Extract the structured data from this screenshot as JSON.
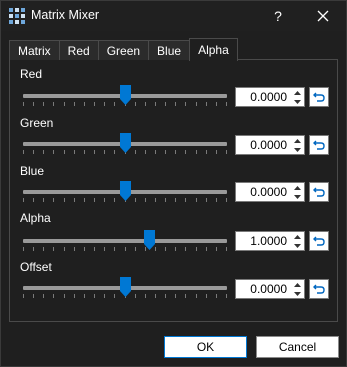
{
  "window": {
    "title": "Matrix Mixer",
    "help_label": "?"
  },
  "tabs": [
    {
      "label": "Matrix",
      "active": false
    },
    {
      "label": "Red",
      "active": false
    },
    {
      "label": "Green",
      "active": false
    },
    {
      "label": "Blue",
      "active": false
    },
    {
      "label": "Alpha",
      "active": true
    }
  ],
  "rows": [
    {
      "label": "Red",
      "value": "0.0000",
      "slider_fraction": 0.5
    },
    {
      "label": "Green",
      "value": "0.0000",
      "slider_fraction": 0.5
    },
    {
      "label": "Blue",
      "value": "0.0000",
      "slider_fraction": 0.5
    },
    {
      "label": "Alpha",
      "value": "1.0000",
      "slider_fraction": 0.62
    },
    {
      "label": "Offset",
      "value": "0.0000",
      "slider_fraction": 0.5
    }
  ],
  "buttons": {
    "ok": "OK",
    "cancel": "Cancel"
  },
  "colors": {
    "accent": "#0078d4",
    "background": "#1f1f1f",
    "text": "#ffffff"
  },
  "icons": {
    "app": "matrix-grid-icon",
    "close": "close-icon",
    "reset": "reset-arrow-icon",
    "spin_up": "chevron-up-icon",
    "spin_down": "chevron-down-icon"
  }
}
